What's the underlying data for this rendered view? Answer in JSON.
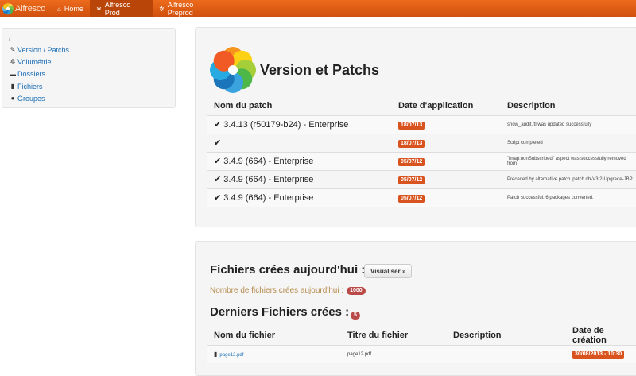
{
  "navbar": {
    "brand": "Alfresco",
    "items": [
      {
        "label": "Home",
        "icon": "home-icon"
      },
      {
        "label": "Alfresco Prod",
        "icon": "gear-icon"
      },
      {
        "label": "Alfresco Preprod",
        "icon": "gear-icon"
      }
    ]
  },
  "sidebar": {
    "root": "/",
    "links": [
      {
        "label": "Version / Patchs",
        "icon": "wrench-icon"
      },
      {
        "label": "Volumétrie",
        "icon": "gear-icon"
      },
      {
        "label": "Dossiers",
        "icon": "folder-icon"
      },
      {
        "label": "Fichiers",
        "icon": "file-icon"
      },
      {
        "label": "Groupes",
        "icon": "user-icon"
      }
    ]
  },
  "patches": {
    "title": "Version et Patchs",
    "headers": [
      "Nom du patch",
      "Date d'application",
      "Description"
    ],
    "rows": [
      {
        "name": "3.4.13 (r50179-b24) - Enterprise",
        "date": "18/07/13",
        "desc": "show_audit.ftl was updated successfully"
      },
      {
        "name": "",
        "date": "18/07/13",
        "desc": "Script completed"
      },
      {
        "name": "3.4.9 (664) - Enterprise",
        "date": "05/07/12",
        "desc": "\"imap:nonSubscribed\" aspect was successfully removed from"
      },
      {
        "name": "3.4.9 (664) - Enterprise",
        "date": "05/07/12",
        "desc": "Preceded by alternative patch 'patch.db-V3.2-Upgrade-JBP"
      },
      {
        "name": "3.4.9 (664) - Enterprise",
        "date": "05/07/12",
        "desc": "Patch successful. 6 packages converted."
      }
    ]
  },
  "files": {
    "today_title": "Fichiers crées aujourd'hui :",
    "view_button": "Visualiser »",
    "count_label": "Nombre de fichiers crées aujourd'hui :",
    "count": "1000",
    "latest_title": "Derniers Fichiers crées :",
    "latest_count": "5",
    "headers": [
      "Nom du fichier",
      "Titre du fichier",
      "Description",
      "Date de création"
    ],
    "rows": [
      {
        "name": "page12.pdf",
        "title": "page12.pdf",
        "desc": "",
        "date": "30/08/2013 - 10:30"
      }
    ]
  }
}
